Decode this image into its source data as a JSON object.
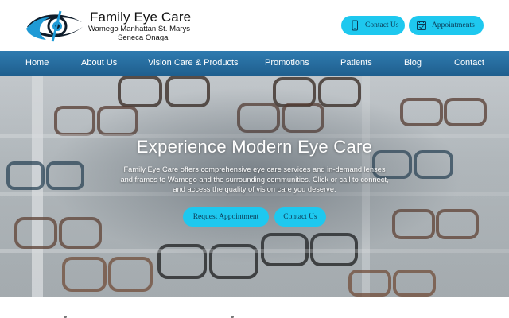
{
  "brand": {
    "name": "Family Eye Care",
    "towns_line1": "Wamego Manhattan St. Marys",
    "towns_line2": "Seneca Onaga",
    "colors": {
      "accent": "#1ec8ef",
      "nav": "#2a70a3",
      "logo_dark": "#0f1d2b",
      "logo_blue": "#1e9ad6"
    }
  },
  "header_buttons": {
    "contact": {
      "label": "Contact Us",
      "icon": "phone-icon"
    },
    "appointments": {
      "label": "Appointments",
      "icon": "calendar-icon"
    }
  },
  "nav": {
    "items": [
      {
        "label": "Home"
      },
      {
        "label": "About Us"
      },
      {
        "label": "Vision Care & Products"
      },
      {
        "label": "Promotions"
      },
      {
        "label": "Patients"
      },
      {
        "label": "Blog"
      },
      {
        "label": "Contact"
      }
    ]
  },
  "hero": {
    "title": "Experience Modern Eye Care",
    "text": "Family Eye Care offers comprehensive eye care services and in-demand lenses and frames to Wamego and the surrounding communities. Click or call to connect, and access the quality of vision care you deserve.",
    "buttons": {
      "request": "Request Appointment",
      "contact": "Contact Us"
    }
  }
}
